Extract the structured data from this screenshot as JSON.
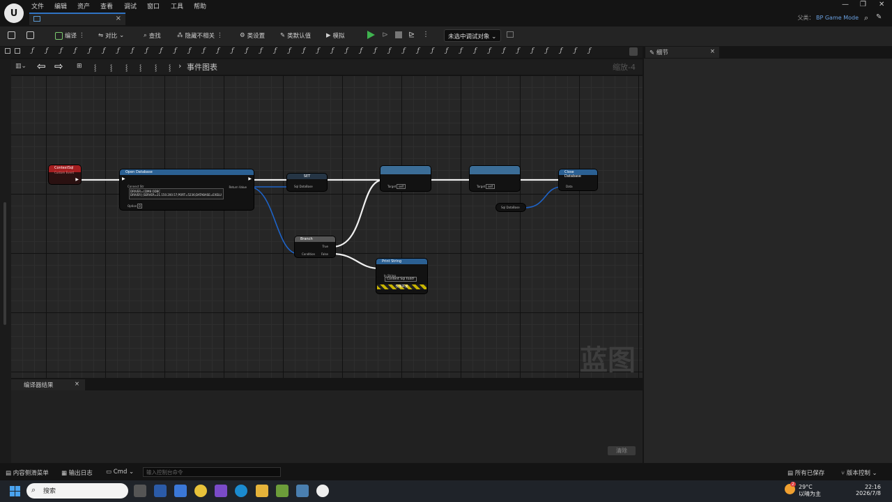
{
  "menu": [
    "文件",
    "编辑",
    "资产",
    "查看",
    "调试",
    "窗口",
    "工具",
    "帮助"
  ],
  "header": {
    "parent_label": "父类：",
    "parent_class": "BP Game Mode"
  },
  "toolbar": {
    "compile": "编译",
    "diff": "对比",
    "find": "查找",
    "hide_unrelated": "隐藏不相关",
    "class_settings": "类设置",
    "class_defaults": "类默认值",
    "simulate": "模拟",
    "debug_select": "未选中调试对象"
  },
  "graph": {
    "breadcrumb": "事件图表",
    "zoom": "缩放-4",
    "watermark": "蓝图"
  },
  "details": {
    "tab": "细节"
  },
  "nodes": {
    "event": "ContextSql",
    "event_sub": "Custom Event",
    "open_db": "Open Database",
    "connect_str_label": "Connect Str",
    "connect_str_line1": "DRIVER={DM8 ODBC",
    "connect_str_line2": "DRIVER};SERVER=21.150.200.57;PORT=5236;DATABASE=EXELU",
    "option_label": "Option",
    "option_value": "0",
    "return_value": "Return Value",
    "set": "SET",
    "sql_database": "Sql DataBase",
    "branch": "Branch",
    "condition": "Condition",
    "true": "True",
    "false": "False",
    "print_string": "Print String",
    "in_string": "In String",
    "in_string_value": "Content Sql Faild!",
    "dev_only": "仅限开发",
    "target": "Target",
    "self": "self",
    "close_db": "Close Database",
    "data": "Data",
    "sql_database_var": "Sql DataBase"
  },
  "compiler": {
    "tab": "编译器结果",
    "clear": "清除"
  },
  "statusbar": {
    "content_drawer": "内容侧滑菜单",
    "output_log": "输出日志",
    "cmd": "Cmd",
    "cmd_placeholder": "输入控制台命令",
    "all_saved": "所有已保存",
    "source_control": "版本控制"
  },
  "taskbar": {
    "search": "搜索",
    "temp": "29°C",
    "weather": "以晴为主",
    "time": "22:16",
    "date": "2026/7/8",
    "badge": "2"
  }
}
